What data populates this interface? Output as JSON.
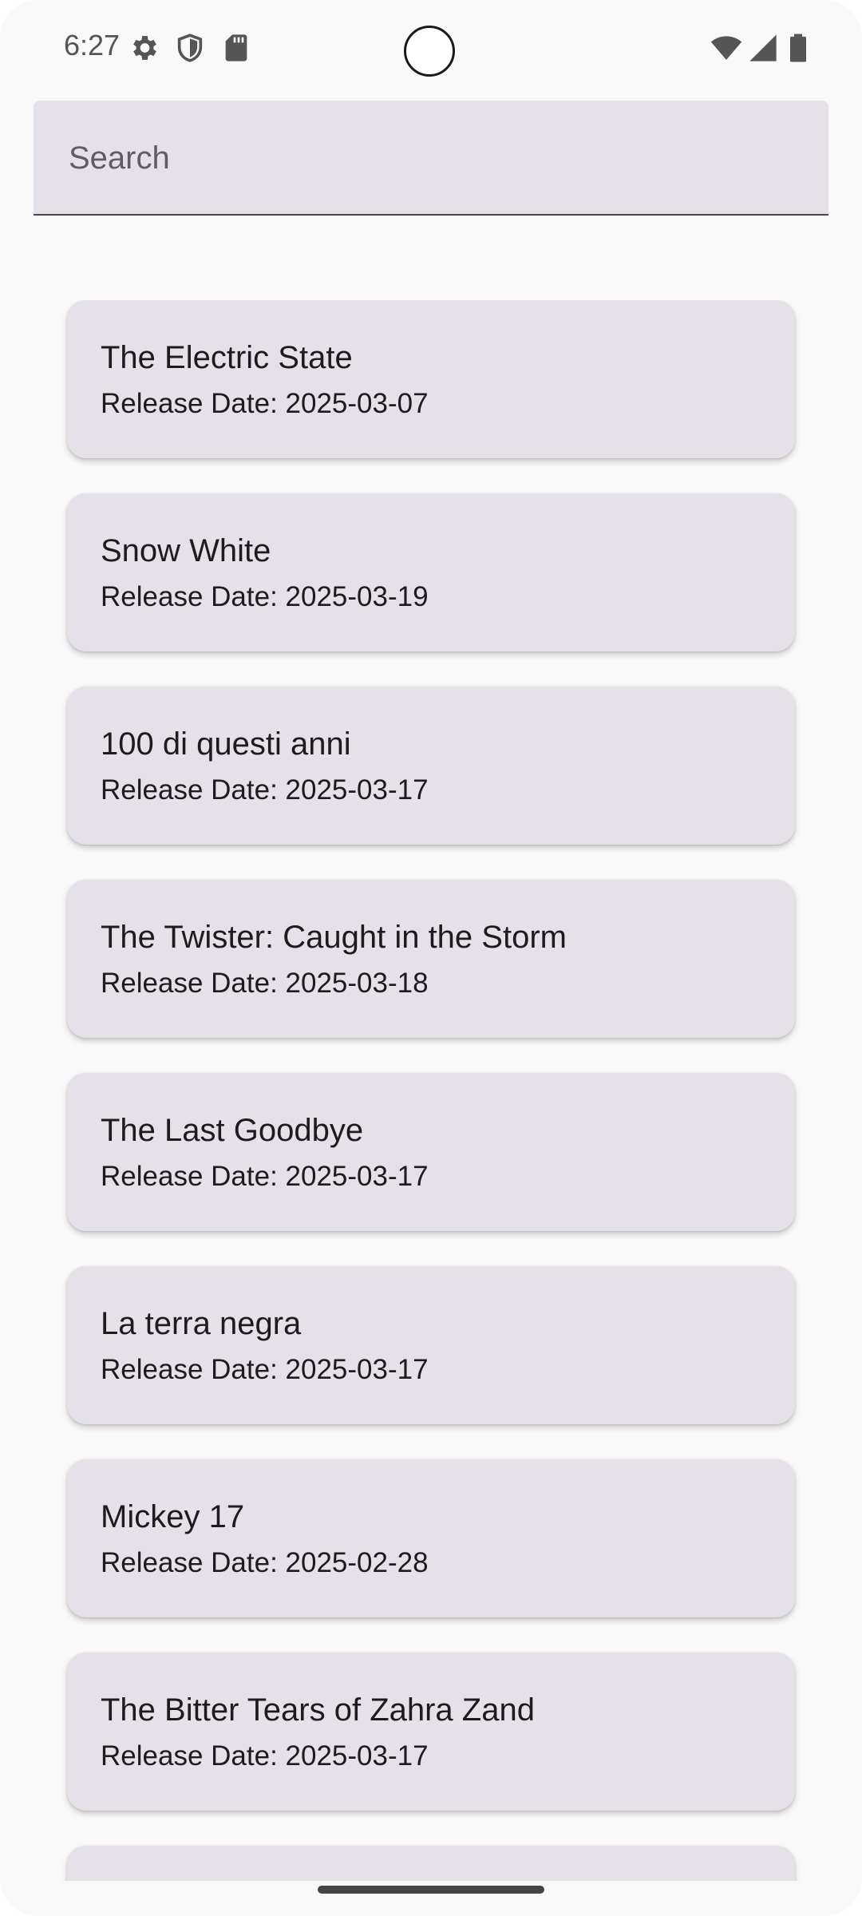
{
  "status_bar": {
    "time": "6:27",
    "icons": [
      "gear-icon",
      "shield-icon",
      "sd-card-icon",
      "wifi-icon",
      "cell-signal-icon",
      "battery-icon"
    ]
  },
  "search": {
    "placeholder": "Search",
    "value": ""
  },
  "movies": [
    {
      "title": "The Electric State",
      "release": "Release Date: 2025-03-07"
    },
    {
      "title": "Snow White",
      "release": "Release Date: 2025-03-19"
    },
    {
      "title": "100 di questi anni",
      "release": "Release Date: 2025-03-17"
    },
    {
      "title": "The Twister: Caught in the Storm",
      "release": "Release Date: 2025-03-18"
    },
    {
      "title": "The Last Goodbye",
      "release": "Release Date: 2025-03-17"
    },
    {
      "title": "La terra negra",
      "release": "Release Date: 2025-03-17"
    },
    {
      "title": "Mickey 17",
      "release": "Release Date: 2025-02-28"
    },
    {
      "title": "The Bitter Tears of Zahra Zand",
      "release": "Release Date: 2025-03-17"
    }
  ],
  "colors": {
    "card": "#e6e0e8",
    "background": "#f9f9f9",
    "text": "#1d1b20"
  }
}
